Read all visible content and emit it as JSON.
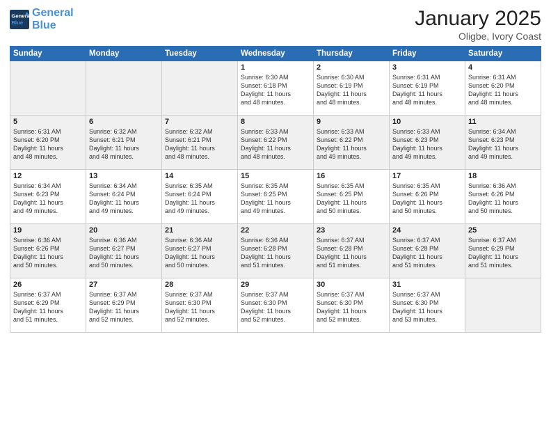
{
  "header": {
    "logo_line1": "General",
    "logo_line2": "Blue",
    "month": "January 2025",
    "location": "Oligbe, Ivory Coast"
  },
  "weekdays": [
    "Sunday",
    "Monday",
    "Tuesday",
    "Wednesday",
    "Thursday",
    "Friday",
    "Saturday"
  ],
  "weeks": [
    [
      {
        "day": "",
        "info": ""
      },
      {
        "day": "",
        "info": ""
      },
      {
        "day": "",
        "info": ""
      },
      {
        "day": "1",
        "info": "Sunrise: 6:30 AM\nSunset: 6:18 PM\nDaylight: 11 hours\nand 48 minutes."
      },
      {
        "day": "2",
        "info": "Sunrise: 6:30 AM\nSunset: 6:19 PM\nDaylight: 11 hours\nand 48 minutes."
      },
      {
        "day": "3",
        "info": "Sunrise: 6:31 AM\nSunset: 6:19 PM\nDaylight: 11 hours\nand 48 minutes."
      },
      {
        "day": "4",
        "info": "Sunrise: 6:31 AM\nSunset: 6:20 PM\nDaylight: 11 hours\nand 48 minutes."
      }
    ],
    [
      {
        "day": "5",
        "info": "Sunrise: 6:31 AM\nSunset: 6:20 PM\nDaylight: 11 hours\nand 48 minutes."
      },
      {
        "day": "6",
        "info": "Sunrise: 6:32 AM\nSunset: 6:21 PM\nDaylight: 11 hours\nand 48 minutes."
      },
      {
        "day": "7",
        "info": "Sunrise: 6:32 AM\nSunset: 6:21 PM\nDaylight: 11 hours\nand 48 minutes."
      },
      {
        "day": "8",
        "info": "Sunrise: 6:33 AM\nSunset: 6:22 PM\nDaylight: 11 hours\nand 48 minutes."
      },
      {
        "day": "9",
        "info": "Sunrise: 6:33 AM\nSunset: 6:22 PM\nDaylight: 11 hours\nand 49 minutes."
      },
      {
        "day": "10",
        "info": "Sunrise: 6:33 AM\nSunset: 6:23 PM\nDaylight: 11 hours\nand 49 minutes."
      },
      {
        "day": "11",
        "info": "Sunrise: 6:34 AM\nSunset: 6:23 PM\nDaylight: 11 hours\nand 49 minutes."
      }
    ],
    [
      {
        "day": "12",
        "info": "Sunrise: 6:34 AM\nSunset: 6:23 PM\nDaylight: 11 hours\nand 49 minutes."
      },
      {
        "day": "13",
        "info": "Sunrise: 6:34 AM\nSunset: 6:24 PM\nDaylight: 11 hours\nand 49 minutes."
      },
      {
        "day": "14",
        "info": "Sunrise: 6:35 AM\nSunset: 6:24 PM\nDaylight: 11 hours\nand 49 minutes."
      },
      {
        "day": "15",
        "info": "Sunrise: 6:35 AM\nSunset: 6:25 PM\nDaylight: 11 hours\nand 49 minutes."
      },
      {
        "day": "16",
        "info": "Sunrise: 6:35 AM\nSunset: 6:25 PM\nDaylight: 11 hours\nand 50 minutes."
      },
      {
        "day": "17",
        "info": "Sunrise: 6:35 AM\nSunset: 6:26 PM\nDaylight: 11 hours\nand 50 minutes."
      },
      {
        "day": "18",
        "info": "Sunrise: 6:36 AM\nSunset: 6:26 PM\nDaylight: 11 hours\nand 50 minutes."
      }
    ],
    [
      {
        "day": "19",
        "info": "Sunrise: 6:36 AM\nSunset: 6:26 PM\nDaylight: 11 hours\nand 50 minutes."
      },
      {
        "day": "20",
        "info": "Sunrise: 6:36 AM\nSunset: 6:27 PM\nDaylight: 11 hours\nand 50 minutes."
      },
      {
        "day": "21",
        "info": "Sunrise: 6:36 AM\nSunset: 6:27 PM\nDaylight: 11 hours\nand 50 minutes."
      },
      {
        "day": "22",
        "info": "Sunrise: 6:36 AM\nSunset: 6:28 PM\nDaylight: 11 hours\nand 51 minutes."
      },
      {
        "day": "23",
        "info": "Sunrise: 6:37 AM\nSunset: 6:28 PM\nDaylight: 11 hours\nand 51 minutes."
      },
      {
        "day": "24",
        "info": "Sunrise: 6:37 AM\nSunset: 6:28 PM\nDaylight: 11 hours\nand 51 minutes."
      },
      {
        "day": "25",
        "info": "Sunrise: 6:37 AM\nSunset: 6:29 PM\nDaylight: 11 hours\nand 51 minutes."
      }
    ],
    [
      {
        "day": "26",
        "info": "Sunrise: 6:37 AM\nSunset: 6:29 PM\nDaylight: 11 hours\nand 51 minutes."
      },
      {
        "day": "27",
        "info": "Sunrise: 6:37 AM\nSunset: 6:29 PM\nDaylight: 11 hours\nand 52 minutes."
      },
      {
        "day": "28",
        "info": "Sunrise: 6:37 AM\nSunset: 6:30 PM\nDaylight: 11 hours\nand 52 minutes."
      },
      {
        "day": "29",
        "info": "Sunrise: 6:37 AM\nSunset: 6:30 PM\nDaylight: 11 hours\nand 52 minutes."
      },
      {
        "day": "30",
        "info": "Sunrise: 6:37 AM\nSunset: 6:30 PM\nDaylight: 11 hours\nand 52 minutes."
      },
      {
        "day": "31",
        "info": "Sunrise: 6:37 AM\nSunset: 6:30 PM\nDaylight: 11 hours\nand 53 minutes."
      },
      {
        "day": "",
        "info": ""
      }
    ]
  ]
}
